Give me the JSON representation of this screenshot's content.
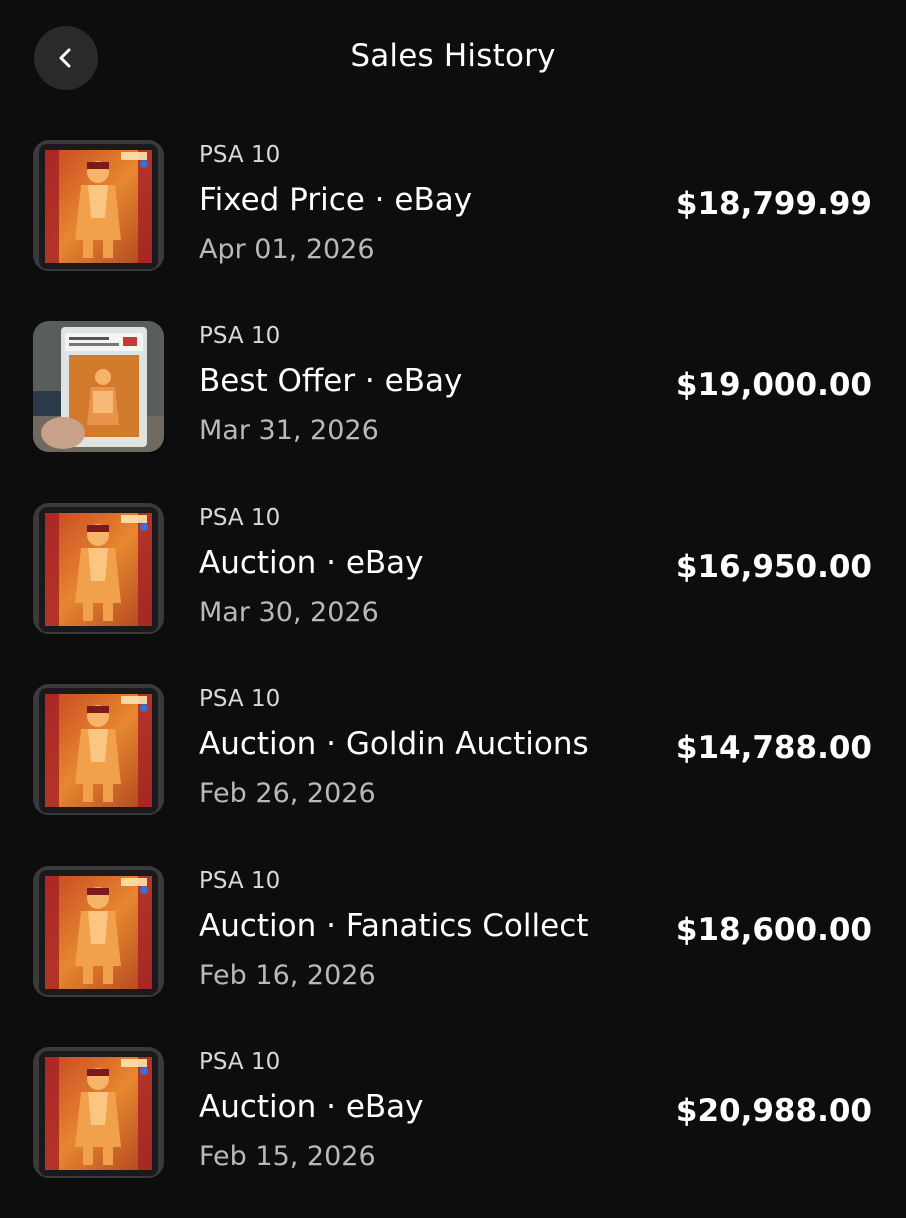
{
  "header": {
    "title": "Sales History",
    "back_icon": "chevron-left-icon"
  },
  "sales": [
    {
      "grade": "PSA 10",
      "type": "Fixed Price · eBay",
      "date": "Apr 01, 2026",
      "price": "$18,799.99",
      "thumb": "slab"
    },
    {
      "grade": "PSA 10",
      "type": "Best Offer · eBay",
      "date": "Mar 31, 2026",
      "price": "$19,000.00",
      "thumb": "photo"
    },
    {
      "grade": "PSA 10",
      "type": "Auction · eBay",
      "date": "Mar 30, 2026",
      "price": "$16,950.00",
      "thumb": "slab"
    },
    {
      "grade": "PSA 10",
      "type": "Auction · Goldin Auctions",
      "date": "Feb 26, 2026",
      "price": "$14,788.00",
      "thumb": "slab"
    },
    {
      "grade": "PSA 10",
      "type": "Auction · Fanatics Collect",
      "date": "Feb 16, 2026",
      "price": "$18,600.00",
      "thumb": "slab"
    },
    {
      "grade": "PSA 10",
      "type": "Auction · eBay",
      "date": "Feb 15, 2026",
      "price": "$20,988.00",
      "thumb": "slab"
    }
  ],
  "colors": {
    "background": "#0d0d0e",
    "back_button": "#2a2a2c",
    "card_orange": "#e07a26",
    "card_red": "#b8242a",
    "text_primary": "#ffffff",
    "text_secondary": "#b9b9bb"
  }
}
